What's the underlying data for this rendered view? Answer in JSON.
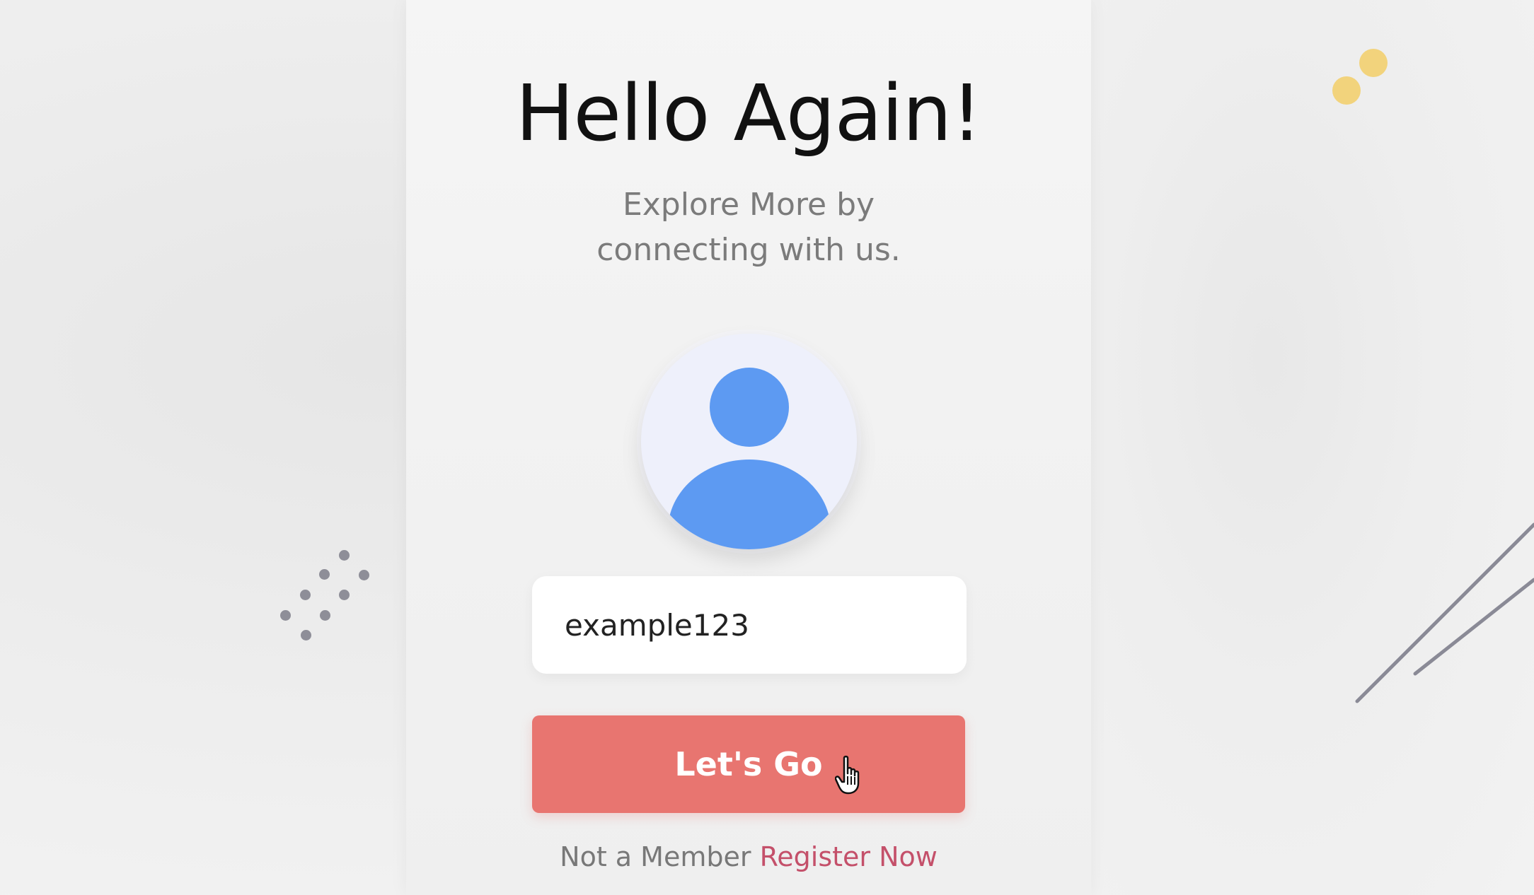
{
  "login": {
    "title": "Hello Again!",
    "subtitle_line1": "Explore More by",
    "subtitle_line2": "connecting with us.",
    "username_value": "example123",
    "submit_label": "Let's Go",
    "footer_text": "Not a Member",
    "register_link": "Register Now"
  },
  "icons": {
    "avatar": "user-avatar-icon",
    "cursor": "hand-pointer-icon"
  },
  "colors": {
    "accent_button": "#e87570",
    "avatar_blue": "#5d9af2",
    "register_link": "#c4506a",
    "deco_yellow": "#f2d37c",
    "deco_gray": "#8e8e98"
  }
}
